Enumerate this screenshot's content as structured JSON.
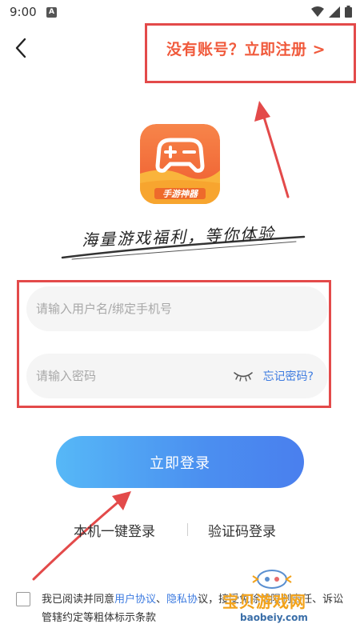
{
  "status_bar": {
    "time": "9:00",
    "notification_letter": "A"
  },
  "header": {
    "register_link": "没有账号？立即注册 >"
  },
  "branding": {
    "logo_caption": "手游神器",
    "slogan": "海量游戏福利，等你体验"
  },
  "form": {
    "username_placeholder": "请输入用户名/绑定手机号",
    "password_placeholder": "请输入密码",
    "forgot_password": "忘记密码?"
  },
  "login_button": "立即登录",
  "alt_login": {
    "one_key": "本机一键登录",
    "sms": "验证码登录"
  },
  "agreement": {
    "prefix": "我已阅读并同意",
    "user_agreement": "用户协议",
    "separator": "、",
    "privacy_policy": "隐私协",
    "suffix": "议，接受免除或限制责任、诉讼管辖约定等粗体标示条款"
  },
  "watermark": {
    "title": "宝贝游戏网",
    "url": "baobeiy.com"
  },
  "colors": {
    "accent_red": "#e34a4a",
    "register_orange": "#f05a3c",
    "link_blue": "#3d7be0",
    "button_gradient_start": "#56b8f7",
    "button_gradient_end": "#4a7fee",
    "logo_orange": "#f4683a"
  }
}
